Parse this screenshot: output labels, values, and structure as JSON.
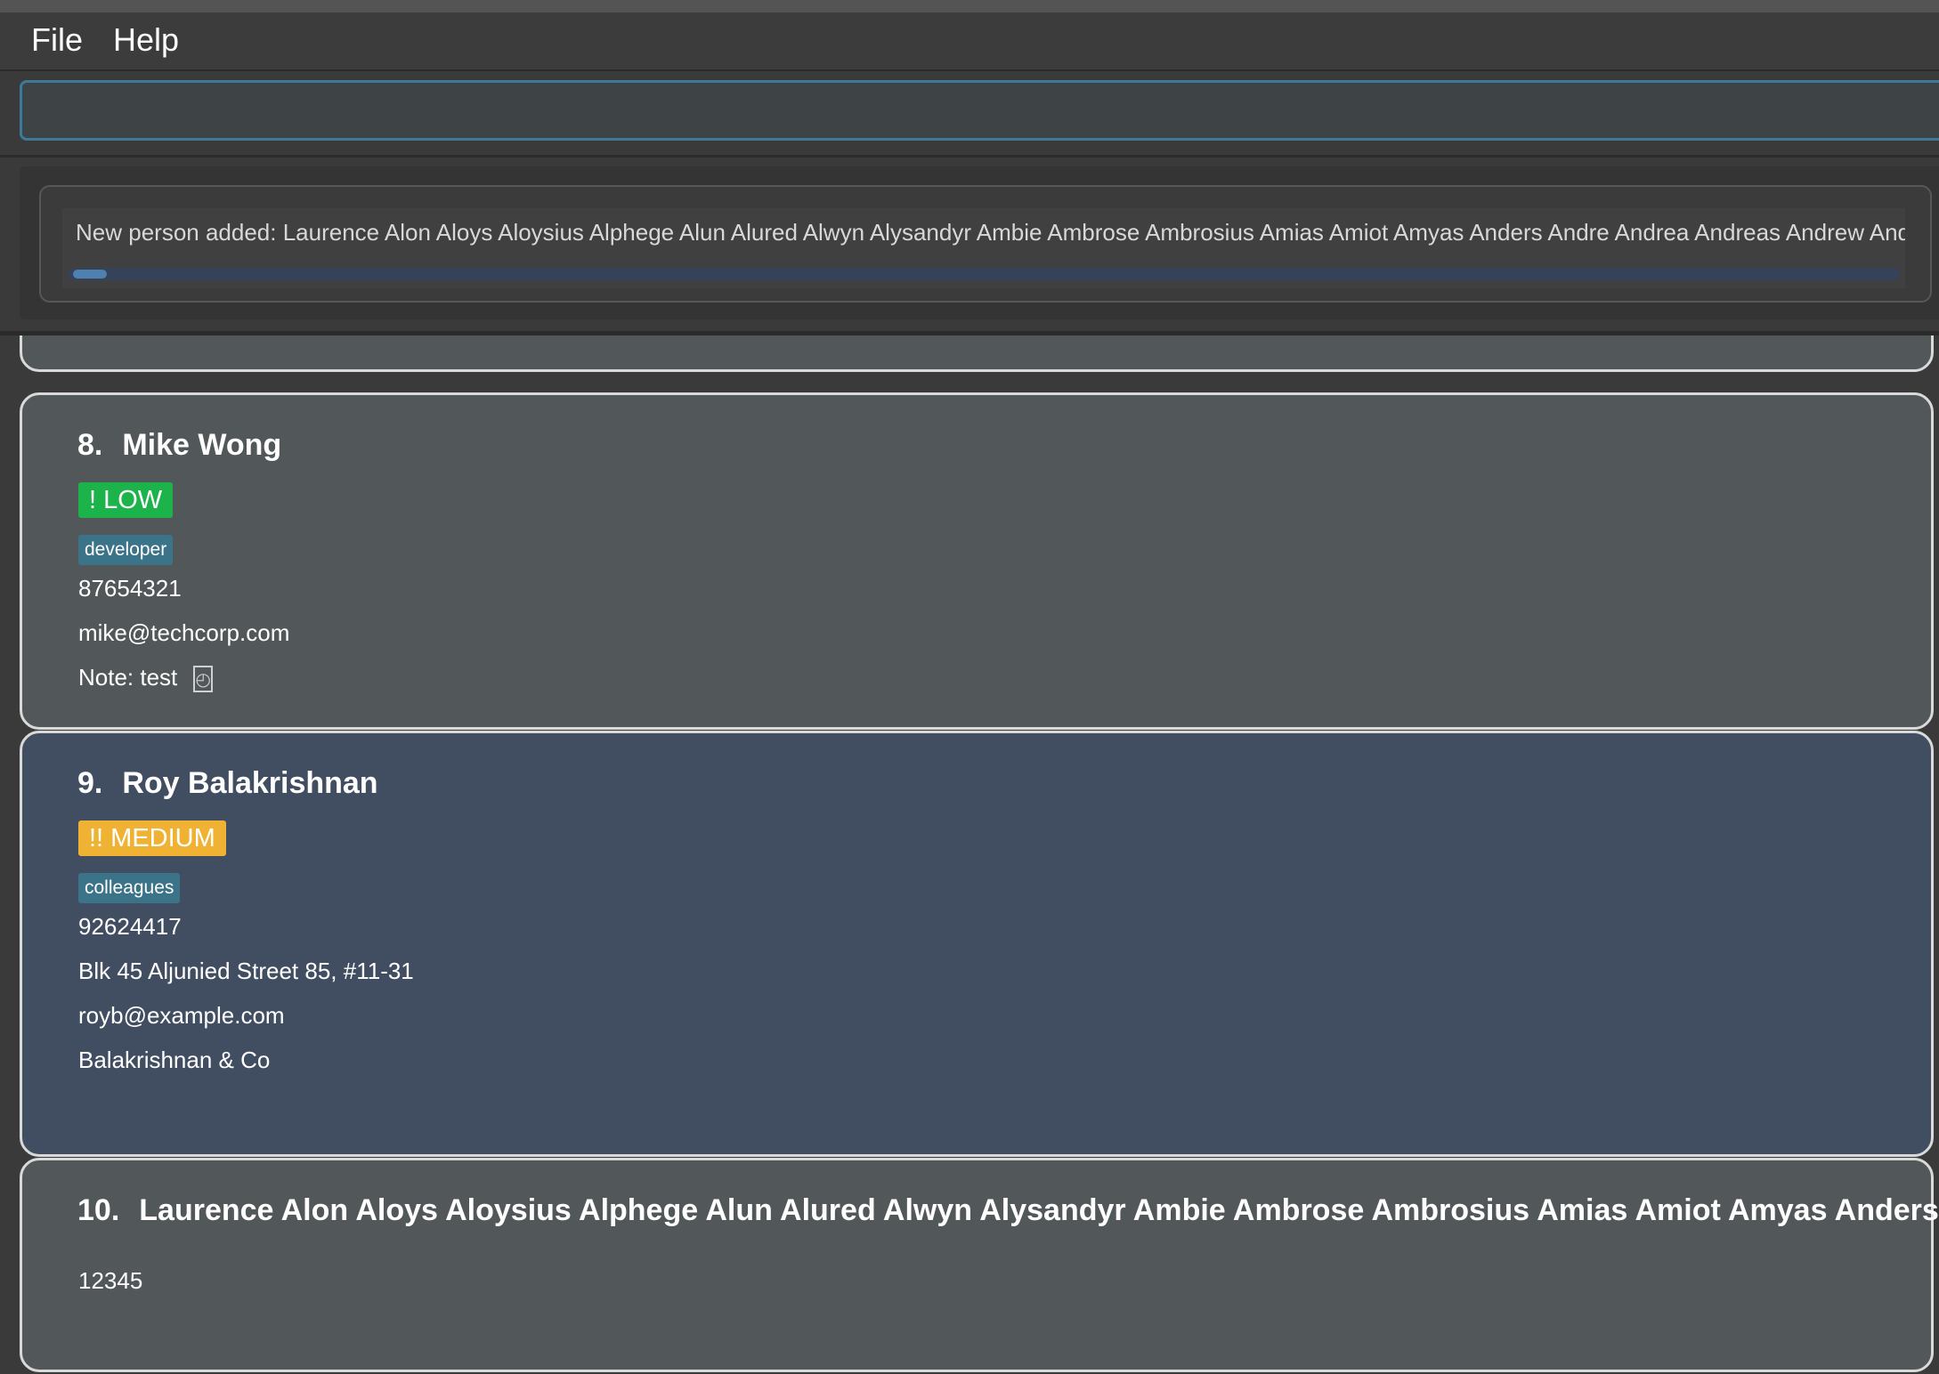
{
  "menu": {
    "file": "File",
    "help": "Help"
  },
  "command_box": {
    "value": ""
  },
  "result_display": {
    "text": "New person added: Laurence Alon Aloys Aloysius Alphege Alun Alured Alwyn Alysandyr Ambie Ambrose Ambrosius Amias Amiot Amyas Anders Andre Andrea Andreas Andrew Andy Aneirin A"
  },
  "persons": [
    {
      "index": "8.",
      "name": "Mike Wong",
      "priority": "! LOW",
      "priority_color": "#1cb34a",
      "tag": "developer",
      "phone": "87654321",
      "email": "mike@techcorp.com",
      "note": "Note: test",
      "note_icon": "clock-icon"
    },
    {
      "index": "9.",
      "name": "Roy Balakrishnan",
      "priority": "!! MEDIUM",
      "priority_color": "#f0b232",
      "tag": "colleagues",
      "phone": "92624417",
      "address": "Blk 45 Aljunied Street 85, #11-31",
      "email": "royb@example.com",
      "company": "Balakrishnan & Co",
      "selected": true
    },
    {
      "index": "10.",
      "name": "Laurence Alon Aloys Aloysius Alphege Alun Alured Alwyn Alysandyr Ambie Ambrose Ambrosius Amias Amiot Amyas Anders Andre Andre...",
      "phone": "12345"
    }
  ],
  "colors": {
    "card_bg": "#525759",
    "selected_card_bg": "#414e62",
    "tag_bg": "#3b7389",
    "input_border": "#3d7a99"
  }
}
